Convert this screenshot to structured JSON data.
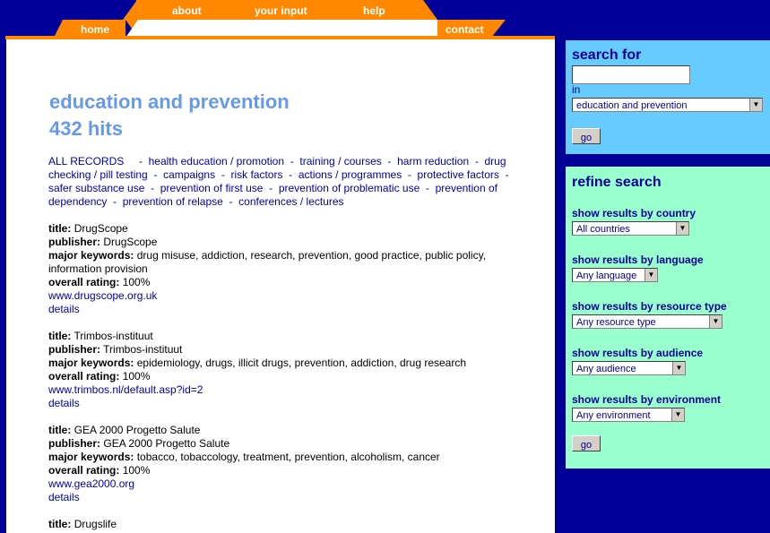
{
  "nav": {
    "about": "about",
    "your_input": "your input",
    "help": "help",
    "home": "home",
    "contact": "contact"
  },
  "main": {
    "title": "education and prevention",
    "hits": "432 hits",
    "categories": [
      "ALL RECORDS",
      "health education / promotion",
      "training / courses",
      "harm reduction",
      "drug checking / pill testing",
      "campaigns",
      "risk factors",
      "actions / programmes",
      "protective factors",
      "safer substance use",
      "prevention of first use",
      "prevention of problematic use",
      "prevention of dependency",
      "prevention of relapse",
      "conferences / lectures"
    ],
    "labels": {
      "title": "title:",
      "publisher": "publisher:",
      "keywords": "major keywords:",
      "rating": "overall rating:",
      "details": "details"
    },
    "records": [
      {
        "title": "DrugScope",
        "publisher": "DrugScope",
        "keywords": "drug misuse, addiction, research, prevention, good practice, public policy, information provision",
        "rating": "100%",
        "url": "www.drugscope.org.uk"
      },
      {
        "title": "Trimbos-instituut",
        "publisher": "Trimbos-instituut",
        "keywords": "epidemiology, drugs, illicit drugs, prevention, addiction, drug research",
        "rating": "100%",
        "url": "www.trimbos.nl/default.asp?id=2"
      },
      {
        "title": "GEA 2000 Progetto Salute",
        "publisher": "GEA 2000 Progetto Salute",
        "keywords": "tobacco, tobaccology, treatment, prevention, alcoholism, cancer",
        "rating": "100%",
        "url": "www.gea2000.org"
      },
      {
        "title": "Drugslife"
      }
    ]
  },
  "search": {
    "heading": "search for",
    "input_value": "",
    "in_label": "in",
    "scope_selected": "education and prevention",
    "go": "go"
  },
  "refine": {
    "heading": "refine search",
    "country_label": "show results by country",
    "country_selected": "All countries",
    "language_label": "show results by language",
    "language_selected": "Any language",
    "resource_label": "show results by resource type",
    "resource_selected": "Any resource type",
    "audience_label": "show results by audience",
    "audience_selected": "Any audience",
    "environment_label": "show results by environment",
    "environment_selected": "Any environment",
    "go": "go"
  },
  "colors": {
    "background": "#000099",
    "nav_orange": "#ff8800",
    "title_blue": "#6699ee",
    "link_blue": "#0000aa",
    "search_panel": "#66ccff",
    "refine_panel": "#99ffcc"
  }
}
